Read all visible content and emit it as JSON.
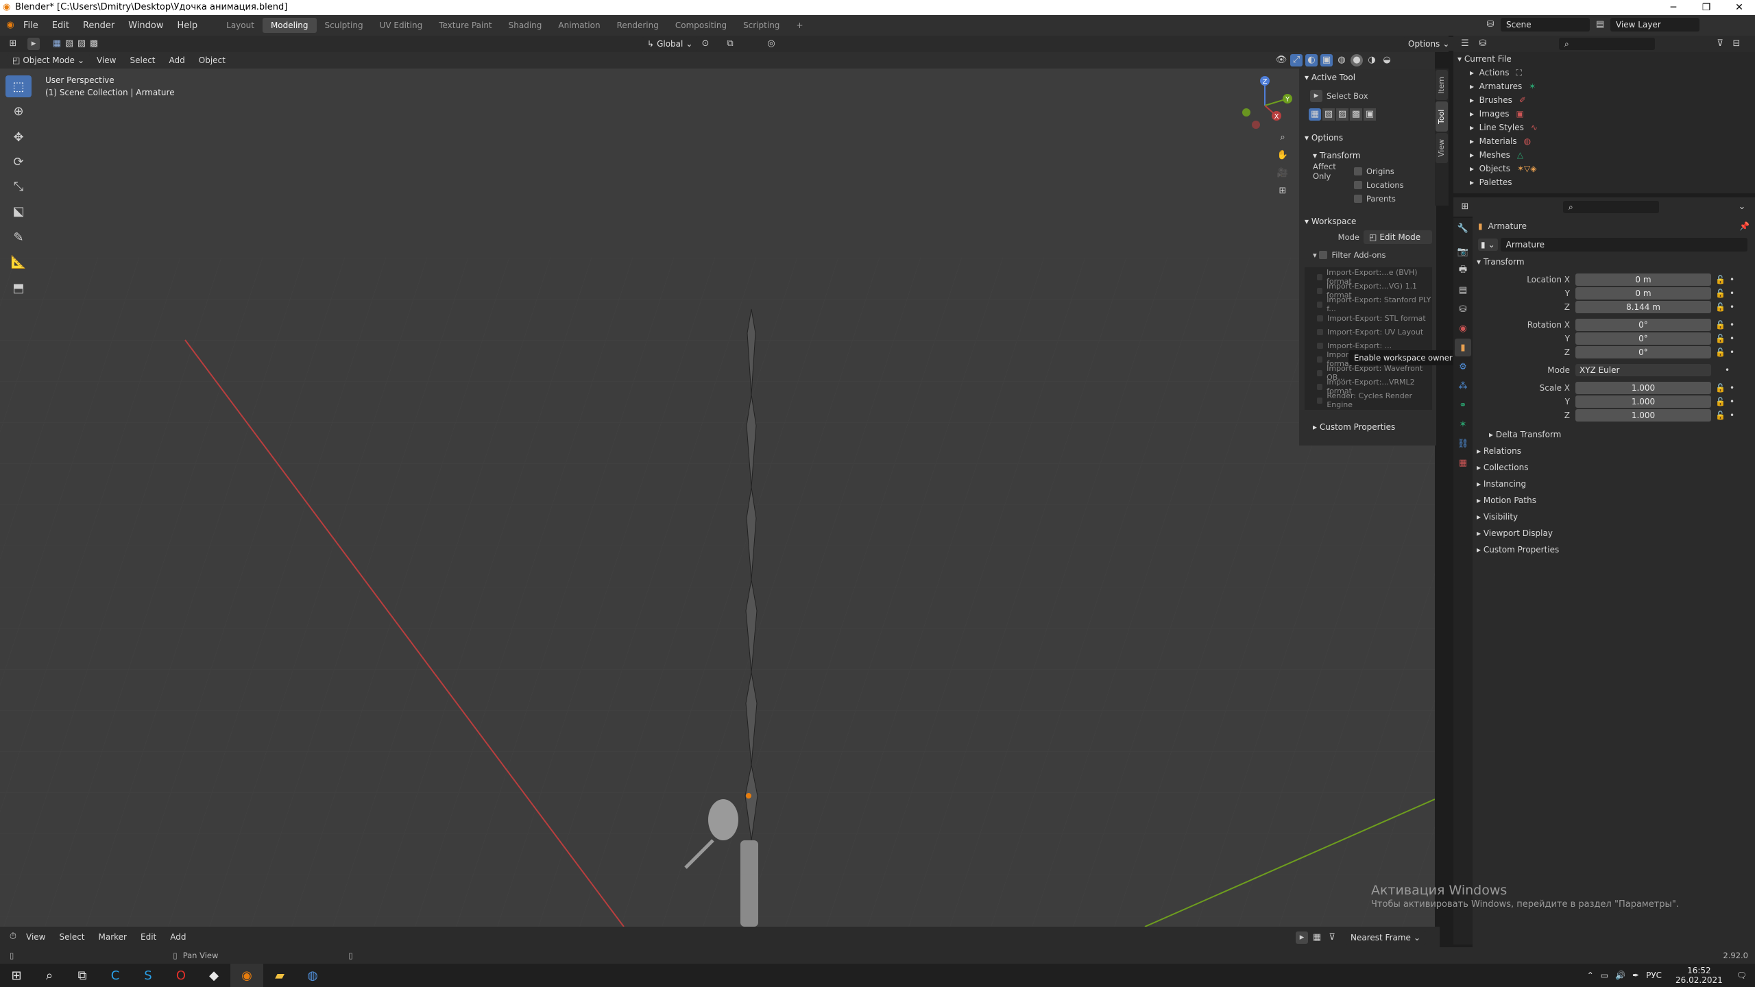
{
  "window": {
    "title": "Blender* [C:\\Users\\Dmitry\\Desktop\\Удочка анимация.blend]",
    "controls": [
      "─",
      "❐",
      "✕"
    ]
  },
  "menubar": {
    "items": [
      "File",
      "Edit",
      "Render",
      "Window",
      "Help"
    ],
    "workspaces": [
      "Layout",
      "Modeling",
      "Sculpting",
      "UV Editing",
      "Texture Paint",
      "Shading",
      "Animation",
      "Rendering",
      "Compositing",
      "Scripting"
    ],
    "active_workspace": "Modeling",
    "add_tab": "+",
    "scene_label": "Scene",
    "view_layer_label": "View Layer"
  },
  "tool_header": {
    "orientation": "Global",
    "options_label": "Options"
  },
  "viewport_header": {
    "mode": "Object Mode",
    "menus": [
      "View",
      "Select",
      "Add",
      "Object"
    ]
  },
  "viewport": {
    "perspective_label": "User Perspective",
    "collection_label": "(1) Scene Collection | Armature",
    "gizmo_axes": {
      "z": "Z",
      "y": "Y",
      "x": "X"
    },
    "colors": {
      "x_axis": "#b93e3e",
      "y_axis": "#6e9e1e",
      "background": "#3d3d3d"
    }
  },
  "npanel": {
    "active_tool_header": "Active Tool",
    "active_tool_name": "Select Box",
    "options_header": "Options",
    "transform_header": "Transform",
    "affect_only_label": "Affect Only",
    "affect_only": [
      "Origins",
      "Locations",
      "Parents"
    ],
    "workspace_header": "Workspace",
    "mode_label": "Mode",
    "mode_value": "Edit Mode",
    "filter_addons_label": "Filter Add-ons",
    "addons": [
      "Import-Export:...e (BVH) format",
      "Import-Export:...VG) 1.1 format",
      "Import-Export: Stanford PLY f...",
      "Import-Export: STL format",
      "Import-Export: UV Layout",
      "Import-Export: ...",
      "Import-Export: glTF 2.0 format",
      "Import-Export: Wavefront OB...",
      "Import-Export:...VRML2 format",
      "Render: Cycles Render Engine"
    ],
    "custom_properties": "Custom Properties",
    "tabs": [
      "Item",
      "Tool",
      "View"
    ],
    "active_tab": "Tool"
  },
  "tooltip": {
    "text": "Enable workspace owner ID."
  },
  "outliner": {
    "root": "Current File",
    "items": [
      "Actions",
      "Armatures",
      "Brushes",
      "Images",
      "Line Styles",
      "Materials",
      "Meshes",
      "Objects",
      "Palettes"
    ]
  },
  "properties": {
    "object_name": "Armature",
    "data_name": "Armature",
    "transform_header": "Transform",
    "location": {
      "label": "Location X",
      "x": "0 m",
      "y": "0 m",
      "z": "8.144 m"
    },
    "rotation": {
      "label": "Rotation X",
      "x": "0°",
      "y": "0°",
      "z": "0°"
    },
    "mode_label": "Mode",
    "mode_value": "XYZ Euler",
    "scale": {
      "label": "Scale X",
      "x": "1.000",
      "y": "1.000",
      "z": "1.000"
    },
    "axis_y": "Y",
    "axis_z": "Z",
    "delta_transform": "Delta Transform",
    "sections": [
      "Relations",
      "Collections",
      "Instancing",
      "Motion Paths",
      "Visibility",
      "Viewport Display",
      "Custom Properties"
    ]
  },
  "timeline": {
    "menus": [
      "View",
      "Select",
      "Marker",
      "Edit",
      "Add"
    ],
    "snap": "Nearest Frame"
  },
  "statusbar": {
    "action": "Pan View",
    "version": "2.92.0"
  },
  "watermark": {
    "title": "Активация Windows",
    "subtitle": "Чтобы активировать Windows, перейдите в раздел \"Параметры\"."
  },
  "taskbar": {
    "lang": "РУС",
    "time": "16:52",
    "date": "26.02.2021"
  }
}
